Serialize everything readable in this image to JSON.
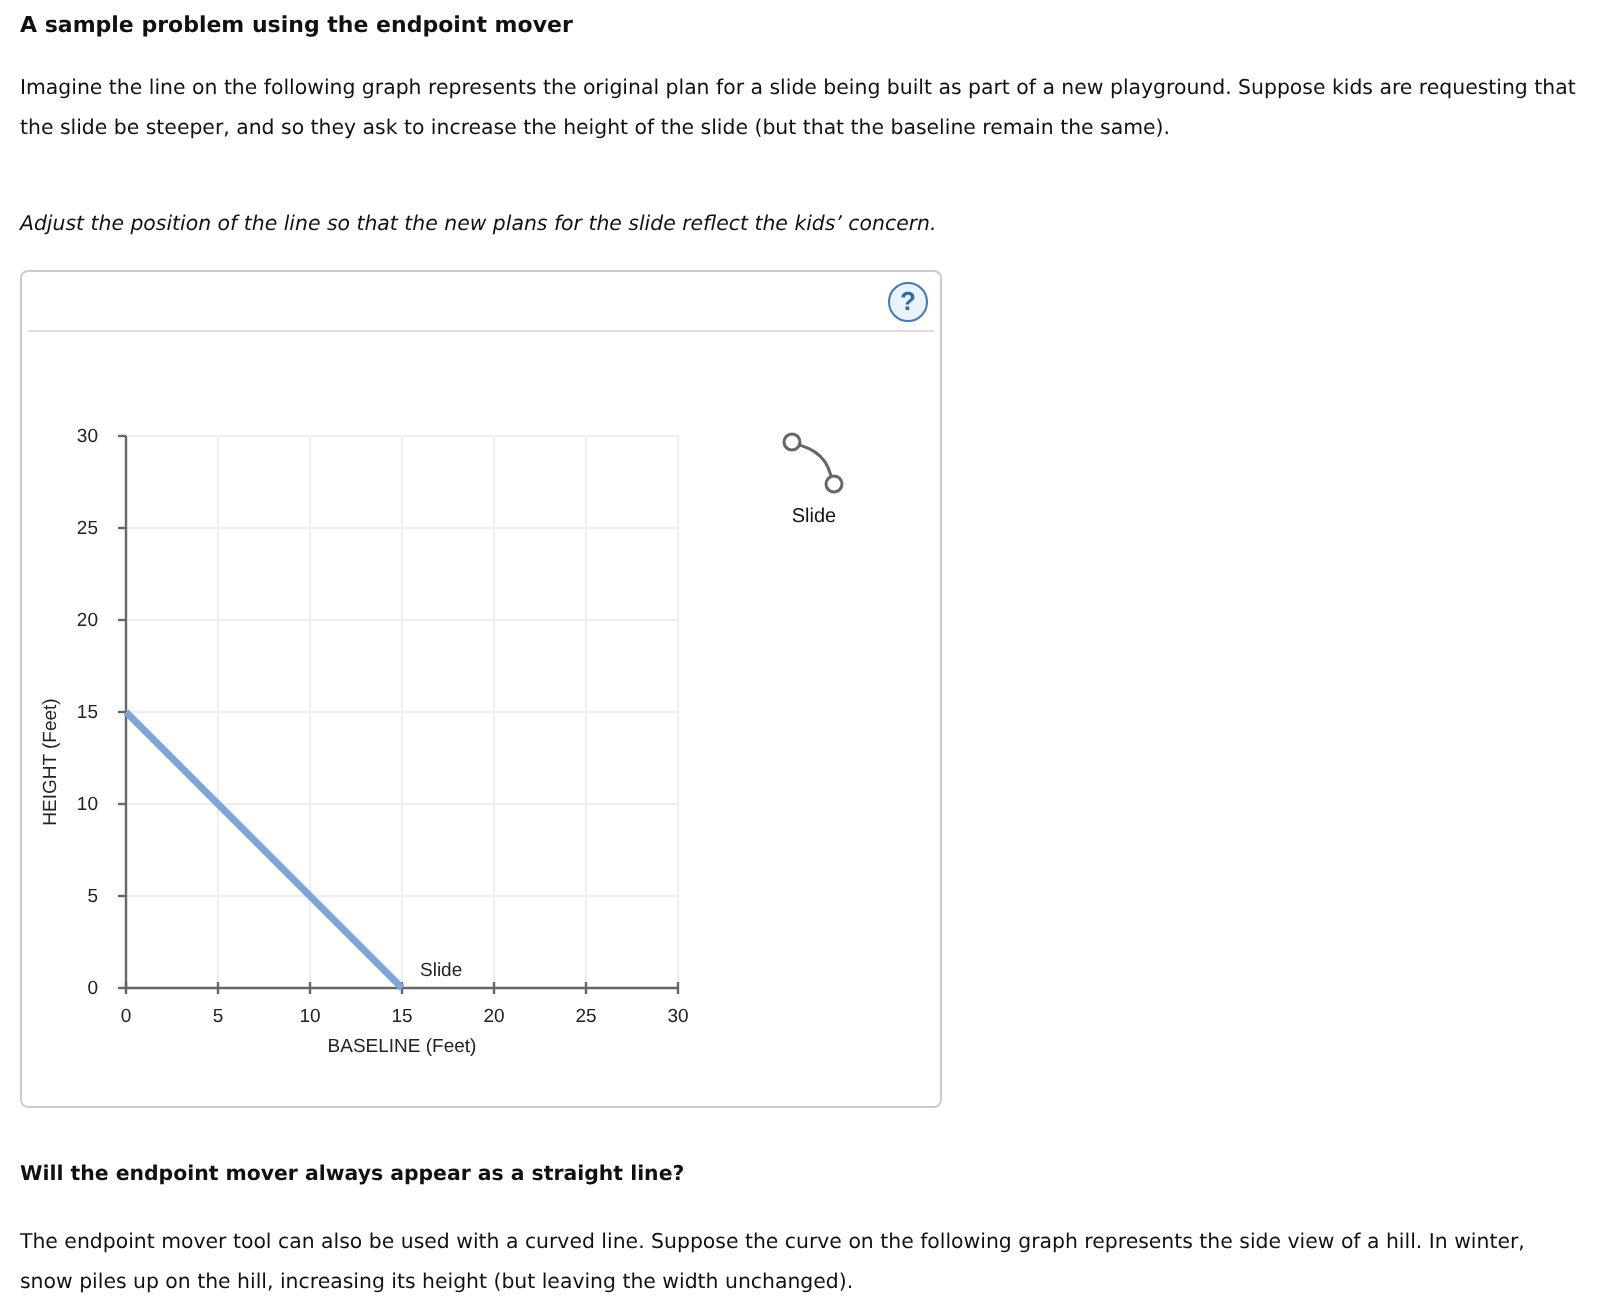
{
  "heading": "A sample problem using the endpoint mover",
  "intro": "Imagine the line on the following graph represents the original plan for a slide being built as part of a new playground. Suppose kids are requesting that the slide be steeper, and so they ask to increase the height of the slide (but that the baseline remain the same).",
  "instruction": "Adjust the position of the line so that the new plans for the slide reflect the kids’ concern.",
  "panel": {
    "help_button": {
      "label": "?"
    },
    "chart_data": {
      "type": "line",
      "xlabel": "BASELINE (Feet)",
      "ylabel": "HEIGHT (Feet)",
      "x": [
        0,
        15
      ],
      "series": [
        {
          "name": "Slide",
          "color": "#7ba7d6",
          "values": [
            15,
            0
          ]
        }
      ],
      "grid": true,
      "xlim": [
        0,
        30
      ],
      "ylim": [
        0,
        30
      ],
      "xticks": [
        0,
        5,
        10,
        15,
        20,
        25,
        30
      ],
      "yticks": [
        0,
        5,
        10,
        15,
        20,
        25,
        30
      ]
    },
    "tools": [
      {
        "kind": "curve",
        "label": "Slide"
      }
    ]
  },
  "question": "Will the endpoint mover always appear as a straight line?",
  "followup": "The endpoint mover tool can also be used with a curved line. Suppose the curve on the following graph represents the side view of a hill. In winter, snow piles up on the hill, increasing its height (but leaving the width unchanged)."
}
